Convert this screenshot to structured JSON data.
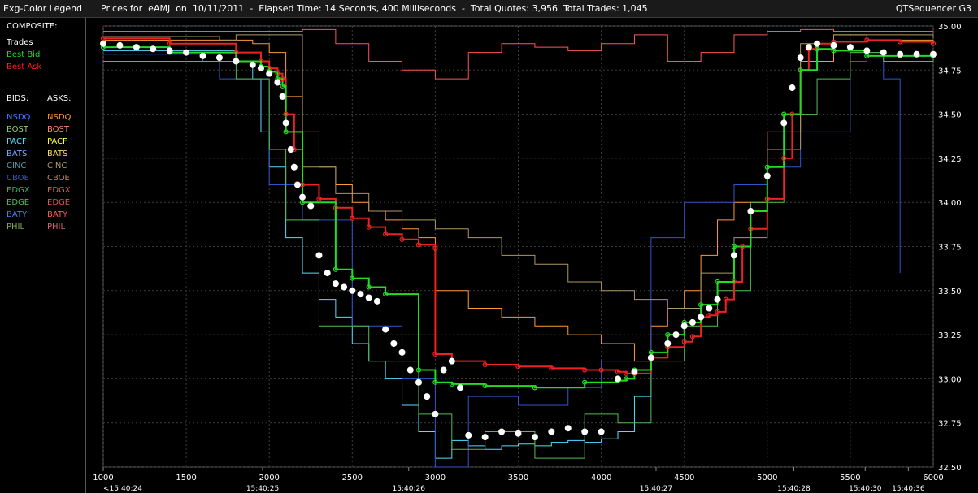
{
  "header": {
    "legend_title": "Exg-Color Legend",
    "chart_title": "Prices for  eAMJ  on  10/11/2011  -  Elapsed Time: 14 Seconds, 400 Milliseconds  -  Total Quotes: 3,956  Total Trades: 1,045",
    "app_name": "QTSequencer G3"
  },
  "legend": {
    "composite_label": "COMPOSITE:",
    "trades_label": "Trades",
    "best_bid_label": "Best Bid",
    "best_ask_label": "Best Ask",
    "bids_label": "BIDS:",
    "asks_label": "ASKS:",
    "exchanges": [
      {
        "name": "NSDQ",
        "bid_color": "#3b7bff",
        "ask_color": "#ff9933"
      },
      {
        "name": "BOST",
        "bid_color": "#99cc66",
        "ask_color": "#ff8866"
      },
      {
        "name": "PACF",
        "bid_color": "#55ddff",
        "ask_color": "#ffff44"
      },
      {
        "name": "BATS",
        "bid_color": "#77aaff",
        "ask_color": "#ffdd55"
      },
      {
        "name": "CINC",
        "bid_color": "#5599aa",
        "ask_color": "#aa9966"
      },
      {
        "name": "CBOE",
        "bid_color": "#3355cc",
        "ask_color": "#cc8844"
      },
      {
        "name": "EDGX",
        "bid_color": "#44aa66",
        "ask_color": "#cc6655"
      },
      {
        "name": "EDGE",
        "bid_color": "#55bb55",
        "ask_color": "#dd5555"
      },
      {
        "name": "BATY",
        "bid_color": "#5577ff",
        "ask_color": "#ff5555"
      },
      {
        "name": "PHIL",
        "bid_color": "#88aa55",
        "ask_color": "#cc6677"
      }
    ],
    "trades_color": "#ffffff",
    "best_bid_color": "#22dd22",
    "best_ask_color": "#ee2222"
  },
  "chart_data": {
    "type": "line",
    "xlim": [
      1000,
      6000
    ],
    "ylim": [
      32.5,
      35.0
    ],
    "y_ticks": [
      "35.00",
      "34.75",
      "34.50",
      "34.25",
      "34.00",
      "33.75",
      "33.50",
      "33.25",
      "33.00",
      "32.75",
      "32.50"
    ],
    "x_ticks": [
      {
        "value": 1000,
        "label": "1000"
      },
      {
        "value": 1500,
        "label": "1500"
      },
      {
        "value": 2000,
        "label": "2000"
      },
      {
        "value": 2500,
        "label": "2500"
      },
      {
        "value": 3000,
        "label": "3000"
      },
      {
        "value": 3500,
        "label": "3500"
      },
      {
        "value": 4000,
        "label": "4000"
      },
      {
        "value": 4500,
        "label": "4500"
      },
      {
        "value": 5000,
        "label": "5000"
      },
      {
        "value": 5500,
        "label": "5500"
      },
      {
        "value": 6000,
        "label": "6000"
      }
    ],
    "time_labels": [
      {
        "value": 1000,
        "label": "<15:40:24"
      },
      {
        "value": 1960,
        "label": "15:40:25"
      },
      {
        "value": 2840,
        "label": "15:40:26"
      },
      {
        "value": 4330,
        "label": "15:40:27"
      },
      {
        "value": 5160,
        "label": "15:40:28"
      },
      {
        "value": 5590,
        "label": "15:40:30"
      },
      {
        "value": 5850,
        "label": "15:40:36"
      }
    ],
    "grid": true,
    "series": [
      {
        "name": "Best Ask",
        "color": "#ee2222",
        "x": [
          1000,
          1400,
          1800,
          1950,
          2000,
          2050,
          2080,
          2100,
          2150,
          2200,
          2300,
          2400,
          2500,
          2600,
          2700,
          2800,
          2900,
          3000,
          3000,
          3100,
          3300,
          3500,
          3700,
          3900,
          4000,
          4100,
          4150,
          4200,
          4300,
          4400,
          4500,
          4550,
          4600,
          4650,
          4700,
          4750,
          4800,
          4850,
          4900,
          5000,
          5100,
          5150,
          5200,
          5250,
          5300,
          5400,
          5600,
          5800,
          6000
        ],
        "y": [
          34.93,
          34.9,
          34.85,
          34.8,
          34.76,
          34.73,
          34.7,
          34.5,
          34.3,
          34.1,
          34.02,
          33.97,
          33.91,
          33.86,
          33.82,
          33.79,
          33.76,
          33.74,
          33.14,
          33.1,
          33.08,
          33.07,
          33.06,
          33.05,
          33.05,
          33.04,
          33.03,
          33.03,
          33.12,
          33.18,
          33.21,
          33.24,
          33.35,
          33.36,
          33.38,
          33.45,
          33.55,
          33.75,
          33.85,
          34.02,
          34.25,
          34.5,
          34.75,
          34.87,
          34.9,
          34.91,
          34.92,
          34.91,
          34.9
        ]
      },
      {
        "name": "Best Bid",
        "color": "#22dd22",
        "x": [
          1000,
          1400,
          1800,
          1950,
          2000,
          2050,
          2080,
          2100,
          2200,
          2400,
          2500,
          2600,
          2700,
          2900,
          3000,
          3100,
          3300,
          3600,
          3900,
          4100,
          4150,
          4200,
          4300,
          4400,
          4500,
          4600,
          4700,
          4800,
          4900,
          5000,
          5100,
          5200,
          5300,
          5400,
          5600,
          5800,
          6000
        ],
        "y": [
          34.88,
          34.85,
          34.8,
          34.77,
          34.74,
          34.7,
          34.66,
          34.4,
          34.0,
          33.62,
          33.57,
          33.52,
          33.48,
          33.05,
          32.98,
          32.97,
          32.96,
          32.95,
          32.98,
          32.99,
          33.0,
          33.05,
          33.15,
          33.25,
          33.32,
          33.42,
          33.55,
          33.75,
          33.95,
          34.2,
          34.5,
          34.75,
          34.87,
          34.86,
          34.83,
          34.83,
          34.83
        ]
      },
      {
        "name": "Trades",
        "color": "#ffffff",
        "x": [
          1000,
          1100,
          1200,
          1300,
          1400,
          1500,
          1600,
          1700,
          1800,
          1900,
          1950,
          2000,
          2050,
          2080,
          2100,
          2130,
          2150,
          2170,
          2200,
          2250,
          2300,
          2350,
          2400,
          2450,
          2500,
          2550,
          2600,
          2650,
          2700,
          2750,
          2800,
          2850,
          2900,
          2950,
          3000,
          3050,
          3100,
          3150,
          3200,
          3300,
          3400,
          3500,
          3600,
          3700,
          3800,
          3900,
          4000,
          4100,
          4200,
          4300,
          4400,
          4450,
          4500,
          4550,
          4600,
          4650,
          4700,
          4800,
          4900,
          5000,
          5100,
          5150,
          5200,
          5250,
          5300,
          5400,
          5500,
          5600,
          5700,
          5800,
          5900,
          6000
        ],
        "y": [
          34.9,
          34.89,
          34.88,
          34.87,
          34.86,
          34.85,
          34.83,
          34.82,
          34.8,
          34.78,
          34.76,
          34.73,
          34.68,
          34.6,
          34.45,
          34.3,
          34.2,
          34.1,
          34.03,
          33.98,
          33.7,
          33.6,
          33.54,
          33.52,
          33.5,
          33.48,
          33.46,
          33.44,
          33.28,
          33.2,
          33.15,
          33.05,
          32.98,
          32.9,
          32.8,
          33.05,
          33.1,
          32.95,
          32.68,
          32.67,
          32.7,
          32.69,
          32.67,
          32.7,
          32.72,
          32.7,
          32.7,
          33.0,
          33.04,
          33.12,
          33.2,
          33.25,
          33.3,
          33.32,
          33.35,
          33.4,
          33.45,
          33.7,
          33.95,
          34.15,
          34.45,
          34.65,
          34.82,
          34.88,
          34.9,
          34.89,
          34.88,
          34.86,
          34.85,
          34.84,
          34.84,
          34.84
        ]
      },
      {
        "name": "NSDQ",
        "color": "#ff9933",
        "x": [
          1000,
          1900,
          2000,
          2100,
          2200,
          2300,
          2400,
          2500,
          2600,
          2700,
          2800,
          2900,
          3000,
          3200,
          3400,
          3600,
          3800,
          4000,
          4200,
          4300,
          4400,
          4500,
          4600,
          4700,
          4800,
          5000,
          5200,
          5400,
          5600,
          6000
        ],
        "y": [
          34.92,
          34.9,
          34.85,
          34.6,
          34.4,
          34.2,
          34.1,
          34.0,
          33.95,
          33.9,
          33.85,
          33.8,
          33.5,
          33.4,
          33.35,
          33.3,
          33.25,
          33.2,
          33.1,
          33.3,
          33.4,
          33.5,
          33.7,
          33.9,
          34.0,
          34.4,
          34.8,
          34.95,
          34.92,
          34.9
        ]
      },
      {
        "name": "PACF",
        "color": "#55ddff",
        "x": [
          1000,
          1800,
          1900,
          1950,
          2000,
          2100,
          2200,
          2300,
          2400,
          2500,
          2600,
          2700,
          2800,
          2900,
          3000,
          3100,
          3200,
          3300,
          3400,
          3500,
          3600,
          3700,
          3800,
          3900,
          4000,
          4100,
          4200,
          4300
        ],
        "y": [
          34.86,
          34.8,
          34.7,
          34.4,
          34.2,
          33.8,
          33.6,
          33.45,
          33.35,
          33.2,
          33.1,
          33.0,
          32.85,
          32.7,
          32.55,
          32.65,
          32.62,
          32.6,
          32.62,
          32.63,
          32.62,
          32.64,
          32.65,
          32.64,
          32.66,
          32.7,
          32.9,
          33.05
        ]
      },
      {
        "name": "CBOE",
        "color": "#3355cc",
        "x": [
          1000,
          1600,
          1700,
          2000,
          2200,
          2500,
          2800,
          3000,
          3200,
          3500,
          3800,
          4000,
          4300,
          4500,
          4800,
          5000,
          5200,
          5500,
          5600,
          5700,
          5800
        ],
        "y": [
          34.84,
          34.8,
          34.7,
          34.1,
          33.9,
          33.3,
          33.0,
          32.5,
          32.9,
          32.85,
          32.95,
          33.1,
          33.8,
          34.0,
          34.1,
          34.2,
          34.4,
          34.8,
          34.85,
          34.7,
          33.6
        ]
      },
      {
        "name": "EDGE",
        "color": "#55bb55",
        "x": [
          1000,
          1800,
          2000,
          2100,
          2300,
          2600,
          2900,
          3100,
          3300,
          3600,
          3900,
          4100,
          4300,
          4500,
          4700,
          4900,
          5100,
          5300,
          5500,
          5700,
          6000
        ],
        "y": [
          34.8,
          34.7,
          34.3,
          33.9,
          33.3,
          33.1,
          32.8,
          32.6,
          32.7,
          32.55,
          32.8,
          32.75,
          33.1,
          33.3,
          33.5,
          34.0,
          34.5,
          34.7,
          34.85,
          34.8,
          34.82
        ]
      },
      {
        "name": "CINC",
        "color": "#aa9966",
        "x": [
          1000,
          1700,
          1800,
          2000,
          2200,
          2400,
          2600,
          2800,
          3000,
          3200,
          3400,
          3600,
          3800,
          4000,
          4200,
          4400,
          4600,
          4800,
          5000,
          5200,
          5400,
          6000
        ],
        "y": [
          34.94,
          34.92,
          34.95,
          34.95,
          34.2,
          34.05,
          33.95,
          33.9,
          33.85,
          33.8,
          33.7,
          33.65,
          33.55,
          33.5,
          33.45,
          33.4,
          33.6,
          33.8,
          34.3,
          34.9,
          34.95,
          34.93
        ]
      },
      {
        "name": "BATY",
        "color": "#ff5555",
        "x": [
          1000,
          2000,
          2200,
          2400,
          2600,
          2800,
          3000,
          3200,
          3400,
          3600,
          3800,
          4000,
          4200,
          4400,
          4600,
          4800,
          5000,
          5200,
          5400,
          6000
        ],
        "y": [
          34.97,
          34.97,
          34.98,
          34.9,
          34.8,
          34.75,
          34.7,
          34.85,
          34.9,
          34.88,
          34.86,
          34.9,
          34.95,
          34.8,
          34.85,
          34.95,
          34.97,
          34.98,
          34.97,
          34.96
        ]
      }
    ]
  }
}
